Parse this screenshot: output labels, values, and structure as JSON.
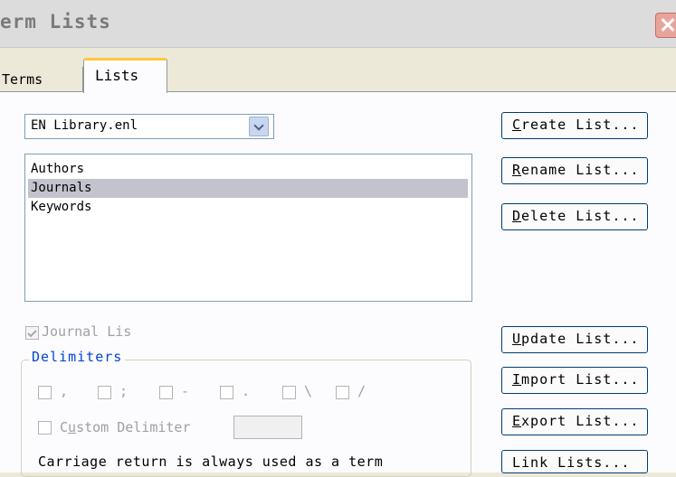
{
  "window": {
    "title": "erm Lists"
  },
  "tabs": [
    {
      "label": "Terms"
    },
    {
      "label": "Lists"
    }
  ],
  "library_select": {
    "value": "EN Library.enl"
  },
  "lists": [
    {
      "label": "Authors"
    },
    {
      "label": "Journals"
    },
    {
      "label": "Keywords"
    }
  ],
  "selected_list": "Journals",
  "buttons": {
    "create": {
      "hot": "C",
      "rest": "reate List..."
    },
    "rename": {
      "hot": "R",
      "rest": "ename List..."
    },
    "delete": {
      "hot": "D",
      "rest": "elete List..."
    },
    "update": {
      "hot": "U",
      "rest": "pdate List..."
    },
    "import": {
      "hot": "I",
      "rest": "mport List..."
    },
    "export": {
      "hot": "E",
      "rest": "xport List..."
    },
    "link": {
      "label": "Link Lists..."
    }
  },
  "journal_checkbox": {
    "label": "Journal Lis",
    "checked": true
  },
  "delimiters": {
    "group_label": "Delimiters",
    "options": [
      {
        "symbol": ",",
        "checked": false
      },
      {
        "symbol": ";",
        "checked": false
      },
      {
        "symbol": "-",
        "checked": false
      },
      {
        "symbol": ".",
        "checked": false
      },
      {
        "symbol": "\\",
        "checked": false
      },
      {
        "symbol": "/",
        "checked": false
      }
    ],
    "custom": {
      "pre": "C",
      "hot": "u",
      "post": "stom Delimiter",
      "checked": false,
      "value": ""
    }
  },
  "note": "Carriage return is always used as a term"
}
